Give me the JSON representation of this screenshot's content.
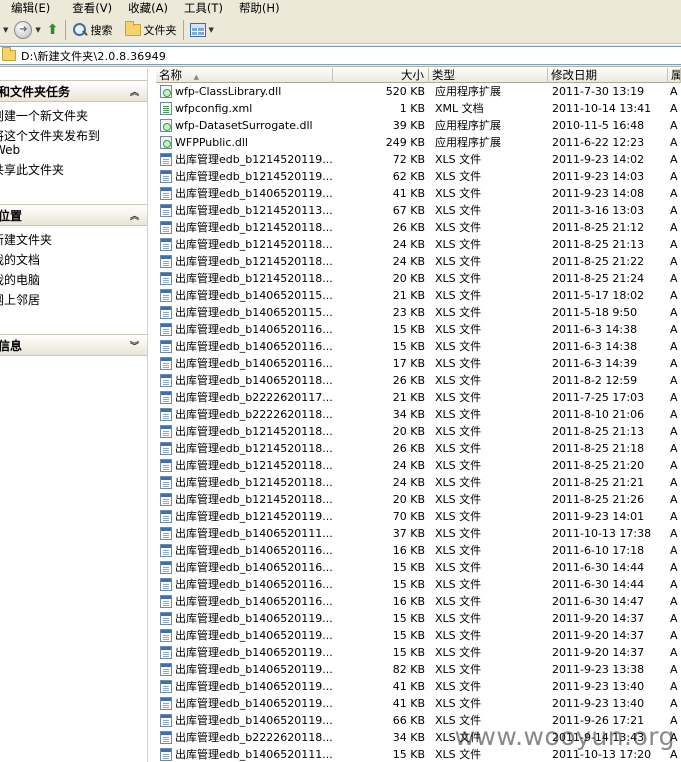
{
  "menu": [
    {
      "label": "编辑(E)"
    },
    {
      "label": "查看(V)"
    },
    {
      "label": "收藏(A)"
    },
    {
      "label": "工具(T)"
    },
    {
      "label": "帮助(H)"
    }
  ],
  "toolbar": {
    "search_label": "搜索",
    "folders_label": "文件夹"
  },
  "address": {
    "path": "D:\\新建文件夹\\2.0.8.36949"
  },
  "sidebar": {
    "tasks": {
      "title": "和文件夹任务",
      "links": [
        "创建一个新文件夹",
        "将这个文件夹发布到",
        "Web",
        "共享此文件夹"
      ]
    },
    "places": {
      "title": "位置",
      "links": [
        "新建文件夹",
        "我的文档",
        "我的电脑",
        "网上邻居"
      ]
    },
    "details": {
      "title": "信息"
    }
  },
  "columns": {
    "name": "名称",
    "size": "大小",
    "type": "类型",
    "date": "修改日期",
    "attr": "属"
  },
  "files": [
    {
      "icon": "dll-icon",
      "name": "wfp-ClassLibrary.dll",
      "size": "520 KB",
      "type": "应用程序扩展",
      "date": "2011-7-30 13:19",
      "attr": "A"
    },
    {
      "icon": "xml-icon",
      "name": "wfpconfig.xml",
      "size": "1 KB",
      "type": "XML 文档",
      "date": "2011-10-14 13:41",
      "attr": "A"
    },
    {
      "icon": "dll-icon",
      "name": "wfp-DatasetSurrogate.dll",
      "size": "39 KB",
      "type": "应用程序扩展",
      "date": "2010-11-5 16:48",
      "attr": "A"
    },
    {
      "icon": "dll-icon",
      "name": "WFPPublic.dll",
      "size": "249 KB",
      "type": "应用程序扩展",
      "date": "2011-6-22 12:23",
      "attr": "A"
    },
    {
      "icon": "xls-icon",
      "name": "出库管理edb_b1214520119...",
      "size": "72 KB",
      "type": "XLS 文件",
      "date": "2011-9-23 14:02",
      "attr": "A"
    },
    {
      "icon": "xls-icon",
      "name": "出库管理edb_b1214520119...",
      "size": "62 KB",
      "type": "XLS 文件",
      "date": "2011-9-23 14:03",
      "attr": "A"
    },
    {
      "icon": "xls-icon",
      "name": "出库管理edb_b1406520119...",
      "size": "41 KB",
      "type": "XLS 文件",
      "date": "2011-9-23 14:08",
      "attr": "A"
    },
    {
      "icon": "xls-icon",
      "name": "出库管理edb_b1214520113...",
      "size": "67 KB",
      "type": "XLS 文件",
      "date": "2011-3-16 13:03",
      "attr": "A"
    },
    {
      "icon": "xls-icon",
      "name": "出库管理edb_b1214520118...",
      "size": "26 KB",
      "type": "XLS 文件",
      "date": "2011-8-25 21:12",
      "attr": "A"
    },
    {
      "icon": "xls-icon",
      "name": "出库管理edb_b1214520118...",
      "size": "24 KB",
      "type": "XLS 文件",
      "date": "2011-8-25 21:13",
      "attr": "A"
    },
    {
      "icon": "xls-icon",
      "name": "出库管理edb_b1214520118...",
      "size": "24 KB",
      "type": "XLS 文件",
      "date": "2011-8-25 21:22",
      "attr": "A"
    },
    {
      "icon": "xls-icon",
      "name": "出库管理edb_b1214520118...",
      "size": "20 KB",
      "type": "XLS 文件",
      "date": "2011-8-25 21:24",
      "attr": "A"
    },
    {
      "icon": "xls-icon",
      "name": "出库管理edb_b1406520115...",
      "size": "21 KB",
      "type": "XLS 文件",
      "date": "2011-5-17 18:02",
      "attr": "A"
    },
    {
      "icon": "xls-icon",
      "name": "出库管理edb_b1406520115...",
      "size": "23 KB",
      "type": "XLS 文件",
      "date": "2011-5-18 9:50",
      "attr": "A"
    },
    {
      "icon": "xls-icon",
      "name": "出库管理edb_b1406520116...",
      "size": "15 KB",
      "type": "XLS 文件",
      "date": "2011-6-3 14:38",
      "attr": "A"
    },
    {
      "icon": "xls-icon",
      "name": "出库管理edb_b1406520116...",
      "size": "15 KB",
      "type": "XLS 文件",
      "date": "2011-6-3 14:38",
      "attr": "A"
    },
    {
      "icon": "xls-icon",
      "name": "出库管理edb_b1406520116...",
      "size": "17 KB",
      "type": "XLS 文件",
      "date": "2011-6-3 14:39",
      "attr": "A"
    },
    {
      "icon": "xls-icon",
      "name": "出库管理edb_b1406520118...",
      "size": "26 KB",
      "type": "XLS 文件",
      "date": "2011-8-2 12:59",
      "attr": "A"
    },
    {
      "icon": "xls-icon",
      "name": "出库管理edb_b2222620117...",
      "size": "21 KB",
      "type": "XLS 文件",
      "date": "2011-7-25 17:03",
      "attr": "A"
    },
    {
      "icon": "xls-icon",
      "name": "出库管理edb_b2222620118...",
      "size": "34 KB",
      "type": "XLS 文件",
      "date": "2011-8-10 21:06",
      "attr": "A"
    },
    {
      "icon": "xls-icon",
      "name": "出库管理edb_b1214520118...",
      "size": "20 KB",
      "type": "XLS 文件",
      "date": "2011-8-25 21:13",
      "attr": "A"
    },
    {
      "icon": "xls-icon",
      "name": "出库管理edb_b1214520118...",
      "size": "26 KB",
      "type": "XLS 文件",
      "date": "2011-8-25 21:18",
      "attr": "A"
    },
    {
      "icon": "xls-icon",
      "name": "出库管理edb_b1214520118...",
      "size": "24 KB",
      "type": "XLS 文件",
      "date": "2011-8-25 21:20",
      "attr": "A"
    },
    {
      "icon": "xls-icon",
      "name": "出库管理edb_b1214520118...",
      "size": "24 KB",
      "type": "XLS 文件",
      "date": "2011-8-25 21:21",
      "attr": "A"
    },
    {
      "icon": "xls-icon",
      "name": "出库管理edb_b1214520118...",
      "size": "20 KB",
      "type": "XLS 文件",
      "date": "2011-8-25 21:26",
      "attr": "A"
    },
    {
      "icon": "xls-icon",
      "name": "出库管理edb_b1214520119...",
      "size": "70 KB",
      "type": "XLS 文件",
      "date": "2011-9-23 14:01",
      "attr": "A"
    },
    {
      "icon": "xls-icon",
      "name": "出库管理edb_b1406520111...",
      "size": "37 KB",
      "type": "XLS 文件",
      "date": "2011-10-13 17:38",
      "attr": "A"
    },
    {
      "icon": "xls-icon",
      "name": "出库管理edb_b1406520116...",
      "size": "16 KB",
      "type": "XLS 文件",
      "date": "2011-6-10 17:18",
      "attr": "A"
    },
    {
      "icon": "xls-icon",
      "name": "出库管理edb_b1406520116...",
      "size": "15 KB",
      "type": "XLS 文件",
      "date": "2011-6-30 14:44",
      "attr": "A"
    },
    {
      "icon": "xls-icon",
      "name": "出库管理edb_b1406520116...",
      "size": "15 KB",
      "type": "XLS 文件",
      "date": "2011-6-30 14:44",
      "attr": "A"
    },
    {
      "icon": "xls-icon",
      "name": "出库管理edb_b1406520116...",
      "size": "16 KB",
      "type": "XLS 文件",
      "date": "2011-6-30 14:47",
      "attr": "A"
    },
    {
      "icon": "xls-icon",
      "name": "出库管理edb_b1406520119...",
      "size": "15 KB",
      "type": "XLS 文件",
      "date": "2011-9-20 14:37",
      "attr": "A"
    },
    {
      "icon": "xls-icon",
      "name": "出库管理edb_b1406520119...",
      "size": "15 KB",
      "type": "XLS 文件",
      "date": "2011-9-20 14:37",
      "attr": "A"
    },
    {
      "icon": "xls-icon",
      "name": "出库管理edb_b1406520119...",
      "size": "15 KB",
      "type": "XLS 文件",
      "date": "2011-9-20 14:37",
      "attr": "A"
    },
    {
      "icon": "xls-icon",
      "name": "出库管理edb_b1406520119...",
      "size": "82 KB",
      "type": "XLS 文件",
      "date": "2011-9-23 13:38",
      "attr": "A"
    },
    {
      "icon": "xls-icon",
      "name": "出库管理edb_b1406520119...",
      "size": "41 KB",
      "type": "XLS 文件",
      "date": "2011-9-23 13:40",
      "attr": "A"
    },
    {
      "icon": "xls-icon",
      "name": "出库管理edb_b1406520119...",
      "size": "41 KB",
      "type": "XLS 文件",
      "date": "2011-9-23 13:40",
      "attr": "A"
    },
    {
      "icon": "xls-icon",
      "name": "出库管理edb_b1406520119...",
      "size": "66 KB",
      "type": "XLS 文件",
      "date": "2011-9-26 17:21",
      "attr": "A"
    },
    {
      "icon": "xls-icon",
      "name": "出库管理edb_b2222620118...",
      "size": "34 KB",
      "type": "XLS 文件",
      "date": "2011-9-14 13:43",
      "attr": "A"
    },
    {
      "icon": "xls-icon",
      "name": "出库管理edb_b1406520111...",
      "size": "15 KB",
      "type": "XLS 文件",
      "date": "2011-10-13 17:20",
      "attr": "A"
    }
  ],
  "watermark": "www.wooyun.org"
}
